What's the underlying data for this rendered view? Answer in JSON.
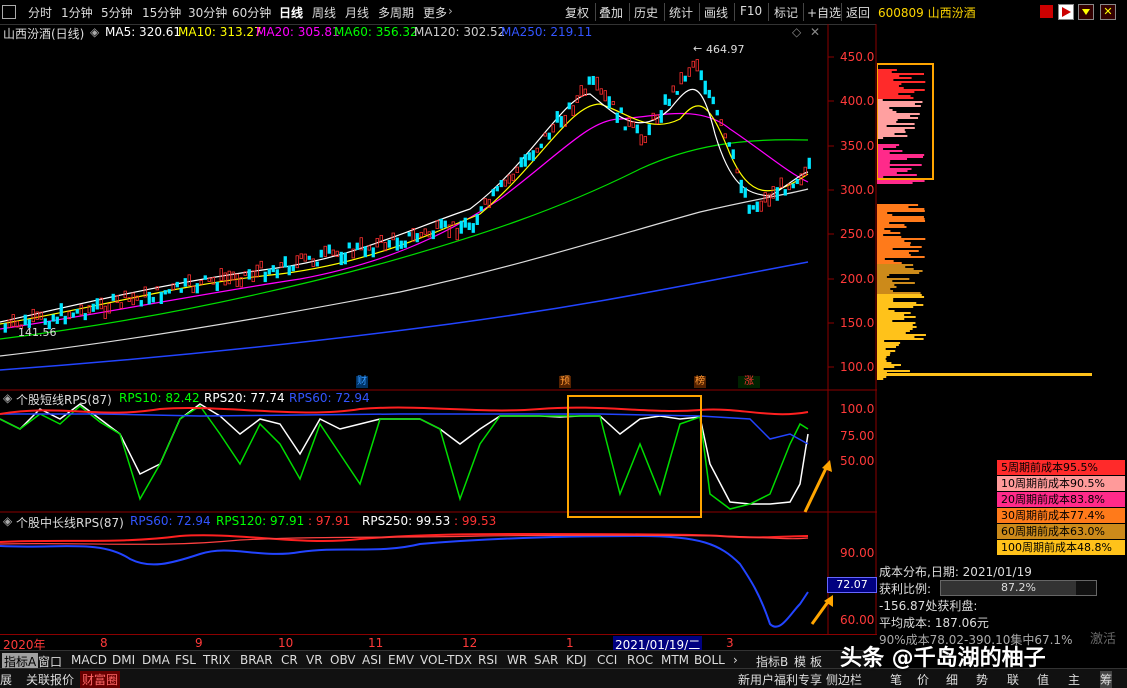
{
  "topbar": {
    "periods": [
      "分时",
      "1分钟",
      "5分钟",
      "15分钟",
      "30分钟",
      "60分钟",
      "日线",
      "周线",
      "月线",
      "多周期",
      "更多"
    ],
    "active_period": "日线",
    "actions": [
      "复权",
      "叠加",
      "历史",
      "统计",
      "画线",
      "F10",
      "标记",
      "+自选",
      "返回"
    ]
  },
  "stock": {
    "code_name": "600809 山西汾酒"
  },
  "main_chart": {
    "title": "山西汾酒(日线)",
    "ma": [
      {
        "label": "MA5: 320.61",
        "color": "#ffffff"
      },
      {
        "label": "MA10: 313.27",
        "color": "#ffff00"
      },
      {
        "label": "MA20: 305.81",
        "color": "#ff00ff"
      },
      {
        "label": "MA60: 356.32",
        "color": "#00ff00"
      },
      {
        "label": "MA120: 302.52",
        "color": "#cccccc"
      },
      {
        "label": "MA250: 219.11",
        "color": "#3355ff"
      }
    ],
    "high_label": "464.97",
    "low_label": "141.56",
    "y_ticks": [
      "450.0",
      "400.0",
      "350.0",
      "300.0",
      "250.0",
      "200.0",
      "150.0",
      "100.0"
    ],
    "markers": [
      {
        "text": "财",
        "color": "#3399ff"
      },
      {
        "text": "预",
        "color": "#ff9933"
      },
      {
        "text": "榜",
        "color": "#ff9933"
      },
      {
        "text": "涨",
        "color": "#ff3333"
      }
    ]
  },
  "rps_short": {
    "title": "个股短线RPS(87)",
    "items": [
      {
        "label": "RPS10: 82.42",
        "color": "#00ff00"
      },
      {
        "label": "RPS20: 77.74",
        "color": "#ffffff"
      },
      {
        "label": "RPS60: 72.94",
        "color": "#3355ff"
      }
    ],
    "y_ticks": [
      "100.0",
      "75.00",
      "50.00"
    ]
  },
  "rps_long": {
    "title": "个股中长线RPS(87)",
    "items": [
      {
        "label": "RPS60: 72.94",
        "color": "#3355ff"
      },
      {
        "label": "RPS120: 97.91",
        "color": "#00ff00"
      },
      {
        "label": ": 97.91",
        "color": "#ff3333"
      },
      {
        "label": "RPS250: 99.53",
        "color": "#ffffff"
      },
      {
        "label": ": 99.53",
        "color": "#ff3333"
      }
    ],
    "y_ticks": [
      "90.00",
      "60.00"
    ],
    "current_value": "72.07"
  },
  "date_axis": {
    "months": [
      "2020年",
      "8",
      "9",
      "10",
      "11",
      "12",
      "1",
      "2021/01/19/二",
      "3"
    ]
  },
  "cost_legend": [
    {
      "label": "5周期前成本95.5%",
      "bg": "#ff2a2a"
    },
    {
      "label": "10周期前成本90.5%",
      "bg": "#ff9a9a"
    },
    {
      "label": "20周期前成本83.8%",
      "bg": "#ff2a8a"
    },
    {
      "label": "30周期前成本77.4%",
      "bg": "#ff7a1a"
    },
    {
      "label": "60周期前成本63.0%",
      "bg": "#cc8a1a"
    },
    {
      "label": "100周期前成本48.8%",
      "bg": "#ffc21a"
    }
  ],
  "cost_info": {
    "date_line": "成本分布,日期:  2021/01/19",
    "profit_label": "获利比例:",
    "profit_value": "87.2%",
    "line3": "-156.87处获利盘:",
    "line4": "平均成本: 187.06元",
    "line5": "90%成本78.02-390.10集中67.1%"
  },
  "indicator_tabs": [
    "指标A",
    "窗口",
    "MACD",
    "DMI",
    "DMA",
    "FSL",
    "TRIX",
    "BRAR",
    "CR",
    "VR",
    "OBV",
    "ASI",
    "EMV",
    "VOL-TDX",
    "RSI",
    "WR",
    "SAR",
    "KDJ",
    "CCI",
    "ROC",
    "MTM",
    "BOLL"
  ],
  "indicator_tabs_right": [
    "指标B",
    "模",
    "板"
  ],
  "status_bar": {
    "items": [
      "展",
      "关联报价",
      "财富圈"
    ],
    "right_items": [
      "新用户福利专享",
      "侧边栏"
    ],
    "bottom_right": [
      "笔",
      "价",
      "细",
      "势",
      "联",
      "值",
      "主",
      "筹"
    ]
  },
  "watermark": "头条 @千岛湖的柚子",
  "overlay_text": "激活"
}
